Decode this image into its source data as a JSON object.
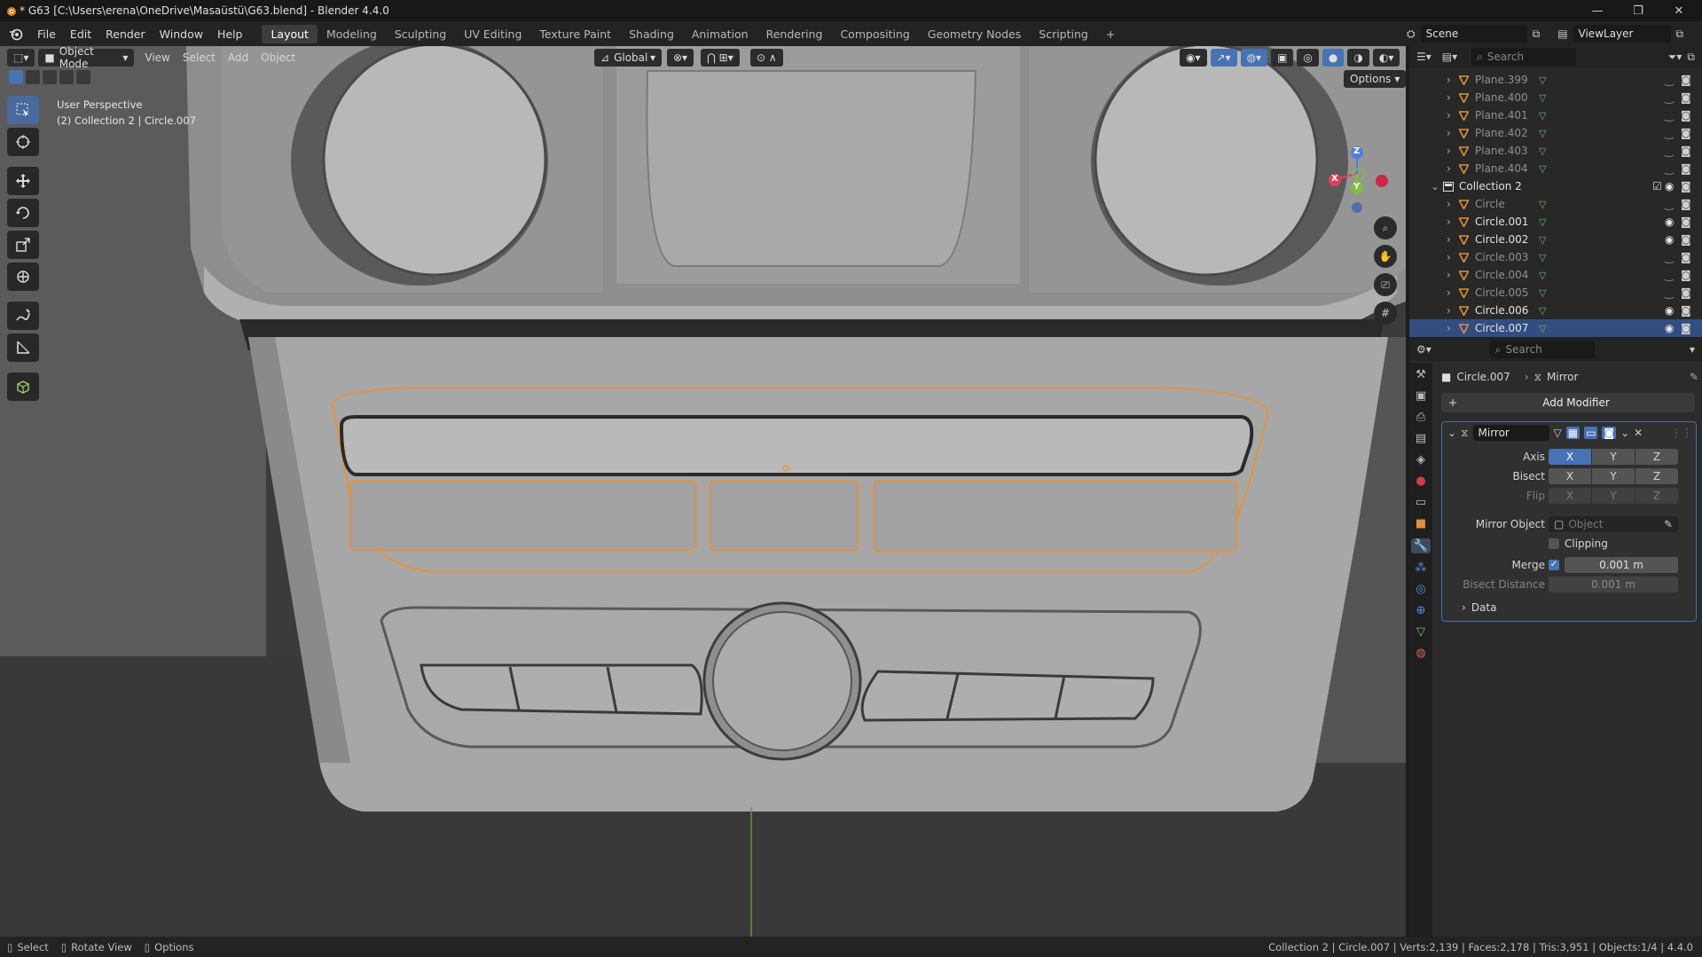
{
  "window": {
    "title": "* G63 [C:\\Users\\erena\\OneDrive\\Masaüstü\\G63.blend] - Blender 4.4.0"
  },
  "menu": [
    "File",
    "Edit",
    "Render",
    "Window",
    "Help"
  ],
  "workspaces": [
    "Layout",
    "Modeling",
    "Sculpting",
    "UV Editing",
    "Texture Paint",
    "Shading",
    "Animation",
    "Rendering",
    "Compositing",
    "Geometry Nodes",
    "Scripting"
  ],
  "active_workspace": "Layout",
  "scene": {
    "name": "Scene",
    "view_layer": "ViewLayer"
  },
  "viewport": {
    "mode": "Object Mode",
    "menus": [
      "View",
      "Select",
      "Add",
      "Object"
    ],
    "orientation": "Global",
    "options_label": "Options",
    "overlay_line1": "User Perspective",
    "overlay_line2": "(2) Collection 2 | Circle.007",
    "gizmo": {
      "x": "X",
      "y": "Y",
      "z": "Z"
    }
  },
  "outliner": {
    "search_placeholder": "Search",
    "items": [
      {
        "name": "Plane.399",
        "dim": true
      },
      {
        "name": "Plane.400",
        "dim": true
      },
      {
        "name": "Plane.401",
        "dim": true
      },
      {
        "name": "Plane.402",
        "dim": true
      },
      {
        "name": "Plane.403",
        "dim": true
      },
      {
        "name": "Plane.404",
        "dim": true
      },
      {
        "name": "Collection 2",
        "collection": true
      },
      {
        "name": "Circle",
        "dim": true
      },
      {
        "name": "Circle.001"
      },
      {
        "name": "Circle.002"
      },
      {
        "name": "Circle.003",
        "dim": true
      },
      {
        "name": "Circle.004",
        "dim": true
      },
      {
        "name": "Circle.005",
        "dim": true
      },
      {
        "name": "Circle.006"
      },
      {
        "name": "Circle.007",
        "selected": true
      }
    ]
  },
  "properties": {
    "search_placeholder": "Search",
    "breadcrumb_object": "Circle.007",
    "breadcrumb_modifier": "Mirror",
    "add_modifier": "Add Modifier",
    "modifier": {
      "name": "Mirror",
      "axis_label": "Axis",
      "bisect_label": "Bisect",
      "flip_label": "Flip",
      "xyz": [
        "X",
        "Y",
        "Z"
      ],
      "mirror_object_label": "Mirror Object",
      "mirror_object_placeholder": "Object",
      "clipping_label": "Clipping",
      "merge_label": "Merge",
      "merge_value": "0.001 m",
      "bisect_distance_label": "Bisect Distance",
      "bisect_distance_value": "0.001 m",
      "data_label": "Data"
    }
  },
  "statusbar": {
    "left": [
      {
        "label": "Select"
      },
      {
        "label": "Rotate View"
      },
      {
        "label": "Options"
      }
    ],
    "right": "Collection 2 | Circle.007 | Verts:2,139 | Faces:2,178 | Tris:3,951 | Objects:1/4 | 4.4.0"
  },
  "colors": {
    "accent": "#4772b3",
    "selection_outline": "#f28c28",
    "selected_row": "#334d80"
  }
}
